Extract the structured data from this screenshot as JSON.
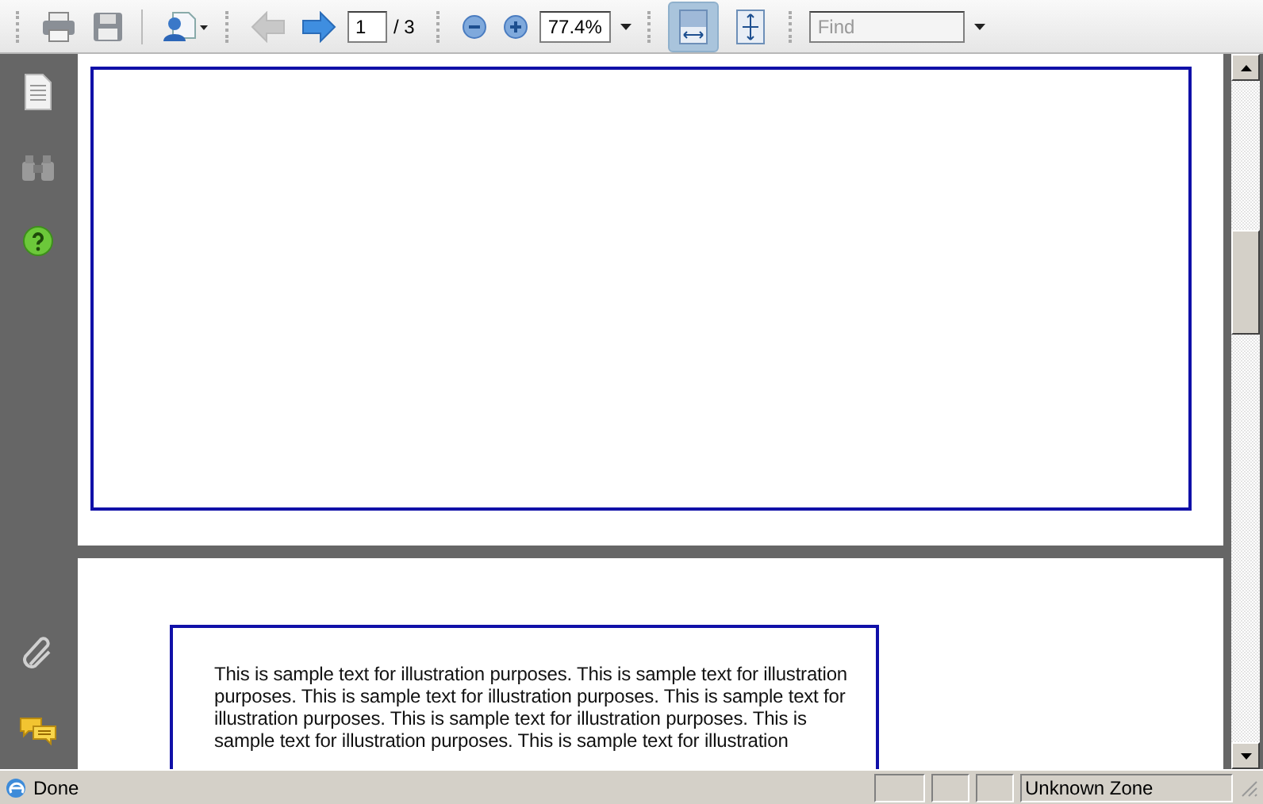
{
  "toolbar": {
    "nav_buttons": [
      {
        "kind": "back",
        "disabled": true
      },
      {
        "kind": "forward",
        "disabled": false
      }
    ],
    "page_field": {
      "value": "1"
    },
    "page_total": "/ 3",
    "zoom_field": {
      "value": "77.4%"
    },
    "view_buttons": [
      {
        "kind": "fit-width",
        "selected": true
      },
      {
        "kind": "fit-page",
        "selected": false
      }
    ],
    "find_field": {
      "placeholder": "Find"
    }
  },
  "document": {
    "pages": [
      {
        "kind": "blank-frame"
      },
      {
        "kind": "text-frame",
        "text": "This is sample text for illustration purposes. This is sample text for illustration purposes. This is sample text for illustration purposes. This is sample text for illustration purposes. This is sample text for illustration purposes. This is sample text for illustration purposes. This is sample text for illustration"
      }
    ]
  },
  "status_bar": {
    "status": "Done",
    "zone": "Unknown Zone"
  }
}
